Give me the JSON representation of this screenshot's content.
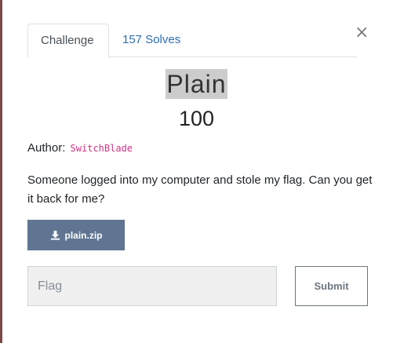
{
  "modal": {
    "close_label": "×",
    "tabs": [
      {
        "label": "Challenge",
        "active": true
      },
      {
        "label": "157 Solves",
        "active": false
      }
    ],
    "challenge": {
      "name": "Plain",
      "value": "100",
      "author_label": "Author:",
      "author_name": "SwitchBlade",
      "description": "Someone logged into my computer and stole my flag. Can you get it back for me?",
      "file": {
        "label": "plain.zip",
        "icon": "download-icon"
      }
    },
    "form": {
      "flag_placeholder": "Flag",
      "flag_value": "",
      "submit_label": "Submit"
    }
  },
  "colors": {
    "tab_link": "#2f6eae",
    "download_bg": "#5f7592",
    "author_name": "#d63384",
    "title_highlight": "#cccccc"
  }
}
